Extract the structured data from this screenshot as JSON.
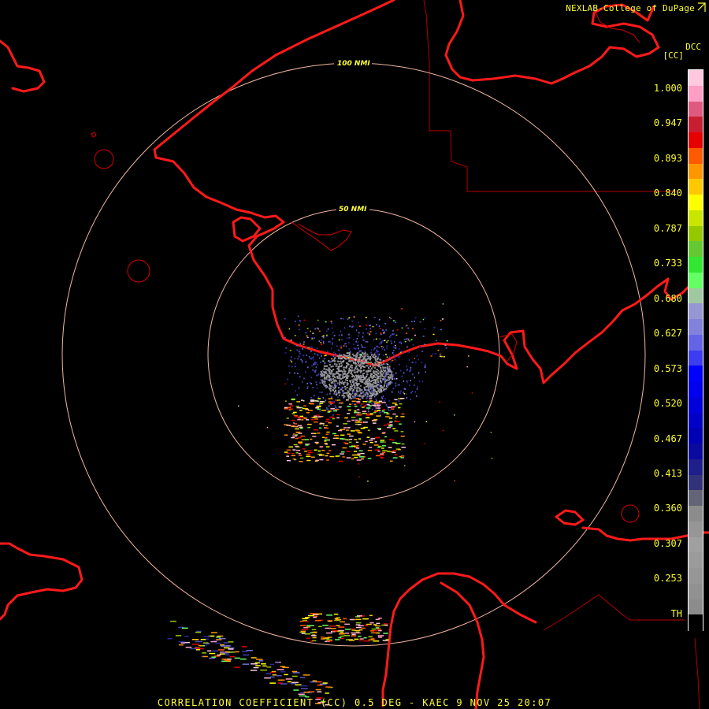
{
  "header": {
    "credit": "NEXLAB-College of DuPage",
    "credit_icon": "arrow-corner-icon",
    "product_code": "DCC",
    "unit": "[CC]"
  },
  "rings": [
    {
      "label": "100 NMI"
    },
    {
      "label": "50 NMI"
    }
  ],
  "colorbar": {
    "ticks": [
      "1.000",
      "0.947",
      "0.893",
      "0.840",
      "0.787",
      "0.733",
      "0.680",
      "0.627",
      "0.573",
      "0.520",
      "0.467",
      "0.413",
      "0.360",
      "0.307",
      "0.253",
      "TH"
    ],
    "segments": [
      "#ffc8dc",
      "#ff9ec4",
      "#e05a80",
      "#c81e32",
      "#e60000",
      "#ff5a00",
      "#ff9600",
      "#ffc800",
      "#ffff00",
      "#c8e600",
      "#96c800",
      "#64c832",
      "#32e632",
      "#64ff64",
      "#a0c8a0",
      "#9696d2",
      "#8282dc",
      "#6464e6",
      "#3c3cf0",
      "#0000ff",
      "#0000f0",
      "#0000dc",
      "#0000c8",
      "#0000b4",
      "#0a0aa0",
      "#1e1e8c",
      "#32327a",
      "#646478",
      "#8c8c8c",
      "#969696",
      "#a0a0a0",
      "#9b9b9b",
      "#969696",
      "#919191",
      "#8c8c8c",
      "#000000"
    ]
  },
  "colors": {
    "coast": "#ff1a1a",
    "county_border": "#cc0000",
    "range_ring": "#f0b6a0",
    "label": "#ffff33"
  },
  "footer": {
    "caption": "CORRELATION COEFFICIENT (CC) 0.5 DEG - KAEC 9 NOV 25 20:07"
  }
}
